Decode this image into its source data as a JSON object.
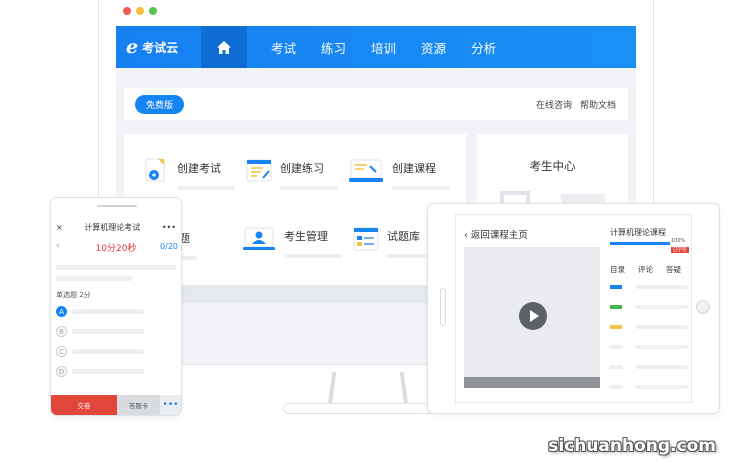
{
  "window": {
    "controls": [
      {
        "name": "close",
        "color": "#ee5c54"
      },
      {
        "name": "minimize",
        "color": "#f6be3b"
      },
      {
        "name": "maximize",
        "color": "#5ac24f"
      }
    ]
  },
  "desktop": {
    "brand": {
      "logo_letter": "e",
      "name": "考试云"
    },
    "nav": {
      "home_icon": "home-icon",
      "items": [
        "考试",
        "练习",
        "培训",
        "资源",
        "分析"
      ]
    },
    "edition_badge": "免费版",
    "top_links": [
      "在线咨询",
      "帮助文档"
    ],
    "functions": [
      {
        "label": "创建考试",
        "icon": "create-exam-icon"
      },
      {
        "label": "创建练习",
        "icon": "create-practice-icon"
      },
      {
        "label": "创建课程",
        "icon": "create-course-icon"
      },
      {
        "label": "量导题",
        "icon": "import-questions-icon"
      },
      {
        "label": "考生管理",
        "icon": "candidate-manage-icon"
      },
      {
        "label": "试题库",
        "icon": "question-bank-icon"
      }
    ],
    "candidate_center": "考生中心"
  },
  "phone": {
    "close": "×",
    "title": "计算机理论考试",
    "menu": "•••",
    "back": "‹",
    "timer": "10分20秒",
    "count": "0/20",
    "question_type": "单选题 2分",
    "options": [
      "A",
      "B",
      "C",
      "D"
    ],
    "selected_option": "A",
    "submit": "交卷",
    "answer_card": "答题卡",
    "more": "•••"
  },
  "tablet": {
    "back": "返回课程主页",
    "course_title": "计算机理论课程",
    "progress_percent": 100,
    "progress_label": "100%",
    "tag": "已学完",
    "tabs": [
      "目录",
      "评论",
      "答疑"
    ],
    "chapter_marks": [
      "#1784f3",
      "#3fb54a",
      "#f5c342"
    ]
  },
  "watermark": "sichuanhong.com"
}
